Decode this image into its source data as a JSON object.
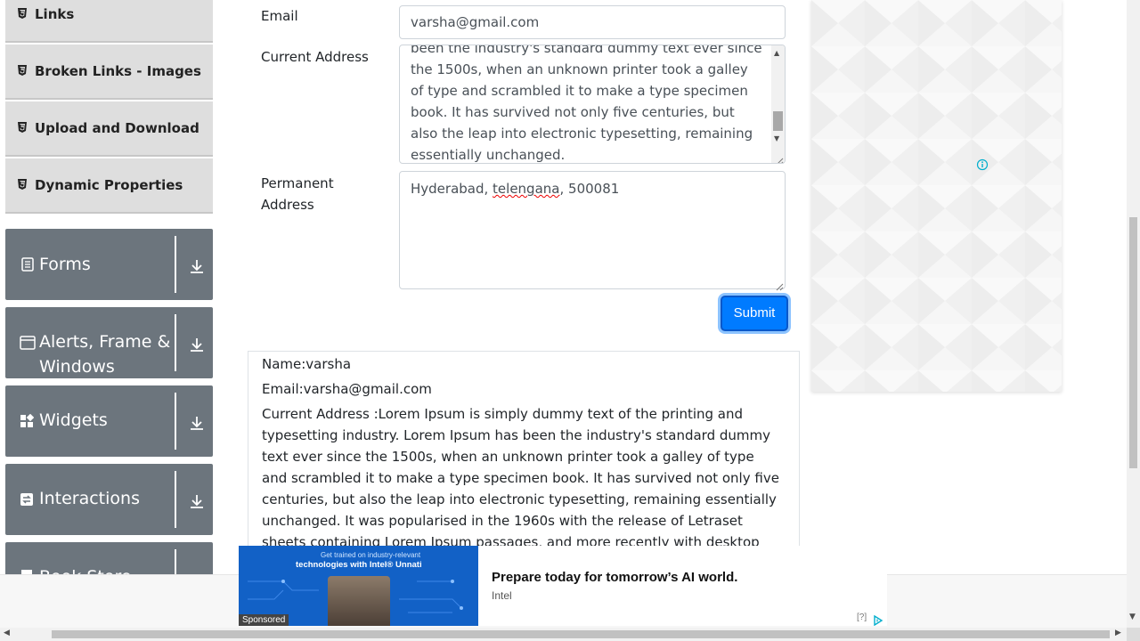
{
  "sidebar": {
    "items": [
      {
        "label": "Links",
        "icon": "html5-icon"
      },
      {
        "label": "Broken Links - Images",
        "icon": "html5-icon"
      },
      {
        "label": "Upload and Download",
        "icon": "html5-icon"
      },
      {
        "label": "Dynamic Properties",
        "icon": "html5-icon"
      }
    ],
    "groups": [
      {
        "label": "Forms",
        "icon": "form-icon"
      },
      {
        "label": "Alerts, Frame & Windows",
        "icon": "window-icon"
      },
      {
        "label": "Widgets",
        "icon": "widgets-icon"
      },
      {
        "label": "Interactions",
        "icon": "interactions-icon"
      },
      {
        "label": "Book Store",
        "icon": "book-icon"
      }
    ]
  },
  "form": {
    "email_label": "Email",
    "email_value": "varsha@gmail.com",
    "current_address_label": "Current Address",
    "current_address_value": "been the industry's standard dummy text ever since the 1500s, when an unknown printer took a galley of type and scrambled it to make a type specimen book. It has survived not only five centuries, but also the leap into electronic typesetting, remaining essentially unchanged.",
    "permanent_address_label_1": "Permanent",
    "permanent_address_label_2": "Address",
    "permanent_address_value_a": "Hyderabad, ",
    "permanent_address_value_b": "telengana",
    "permanent_address_value_c": ", 500081",
    "submit_label": "Submit"
  },
  "output": {
    "name": "Name:varsha",
    "email": "Email:varsha@gmail.com",
    "current_address": "Current Address :Lorem Ipsum is simply dummy text of the printing and typesetting industry. Lorem Ipsum has been the industry's standard dummy text ever since the 1500s, when an unknown printer took a galley of type and scrambled it to make a type specimen book. It has survived not only five centuries, but also the leap into electronic typesetting, remaining essentially unchanged. It was popularised in the 1960s with the release of Letraset sheets containing Lorem Ipsum passages, and more recently with desktop publishing software like Aldus"
  },
  "ad": {
    "image_line1": "Get trained on industry-relevant",
    "image_line2": "technologies with Intel® Unnati",
    "sponsored": "Sponsored",
    "headline": "Prepare today for tomorrow’s AI world.",
    "brand": "Intel",
    "help": "[?]"
  },
  "colors": {
    "sidebar_group_bg": "#6c757d",
    "sidebar_item_bg": "#dedede",
    "primary": "#007bff"
  }
}
